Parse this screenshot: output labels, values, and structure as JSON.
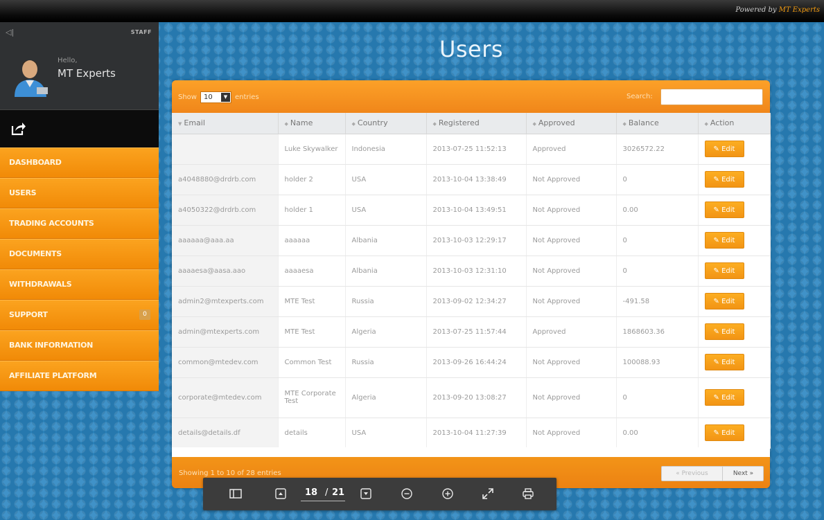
{
  "topbar": {
    "powered_prefix": "Powered by ",
    "powered_brand": "MT Experts"
  },
  "sidebar": {
    "collapse": "◁|",
    "staff_label": "STAFF",
    "hello": "Hello,",
    "user_name": "MT Experts",
    "items": [
      {
        "label": "DASHBOARD"
      },
      {
        "label": "USERS"
      },
      {
        "label": "TRADING ACCOUNTS"
      },
      {
        "label": "DOCUMENTS"
      },
      {
        "label": "WITHDRAWALS"
      },
      {
        "label": "SUPPORT",
        "badge": "0"
      },
      {
        "label": "BANK INFORMATION"
      },
      {
        "label": "AFFILIATE PLATFORM"
      }
    ]
  },
  "page": {
    "title": "Users"
  },
  "panel": {
    "show_label": "Show",
    "entries_value": "10",
    "entries_label": "entries",
    "search_label": "Search:",
    "search_value": "",
    "columns": [
      "Email",
      "Name",
      "Country",
      "Registered",
      "Approved",
      "Balance",
      "Action"
    ],
    "rows": [
      {
        "email": "",
        "name": "Luke Skywalker",
        "country": "Indonesia",
        "registered": "2013-07-25 11:52:13",
        "approved": "Approved",
        "balance": "3026572.22",
        "action": "Edit"
      },
      {
        "email": "a4048880@drdrb.com",
        "name": "holder 2",
        "country": "USA",
        "registered": "2013-10-04 13:38:49",
        "approved": "Not Approved",
        "balance": "0",
        "action": "Edit"
      },
      {
        "email": "a4050322@drdrb.com",
        "name": "holder 1",
        "country": "USA",
        "registered": "2013-10-04 13:49:51",
        "approved": "Not Approved",
        "balance": "0.00",
        "action": "Edit"
      },
      {
        "email": "aaaaaa@aaa.aa",
        "name": "aaaaaa",
        "country": "Albania",
        "registered": "2013-10-03 12:29:17",
        "approved": "Not Approved",
        "balance": "0",
        "action": "Edit"
      },
      {
        "email": "aaaaesa@aasa.aao",
        "name": "aaaaesa",
        "country": "Albania",
        "registered": "2013-10-03 12:31:10",
        "approved": "Not Approved",
        "balance": "0",
        "action": "Edit"
      },
      {
        "email": "admin2@mtexperts.com",
        "name": "MTE Test",
        "country": "Russia",
        "registered": "2013-09-02 12:34:27",
        "approved": "Not Approved",
        "balance": "-491.58",
        "action": "Edit"
      },
      {
        "email": "admin@mtexperts.com",
        "name": "MTE Test",
        "country": "Algeria",
        "registered": "2013-07-25 11:57:44",
        "approved": "Approved",
        "balance": "1868603.36",
        "action": "Edit"
      },
      {
        "email": "common@mtedev.com",
        "name": "Common Test",
        "country": "Russia",
        "registered": "2013-09-26 16:44:24",
        "approved": "Not Approved",
        "balance": "100088.93",
        "action": "Edit"
      },
      {
        "email": "corporate@mtedev.com",
        "name": "MTE Corporate Test",
        "country": "Algeria",
        "registered": "2013-09-20 13:08:27",
        "approved": "Not Approved",
        "balance": "0",
        "action": "Edit"
      },
      {
        "email": "details@details.df",
        "name": "details",
        "country": "USA",
        "registered": "2013-10-04 11:27:39",
        "approved": "Not Approved",
        "balance": "0.00",
        "action": "Edit"
      }
    ],
    "showing": "Showing 1 to 10 of 28 entries",
    "prev": "« Previous",
    "next": "Next »"
  },
  "viewer": {
    "page_current": "18",
    "page_sep": "/",
    "page_total": "21"
  }
}
